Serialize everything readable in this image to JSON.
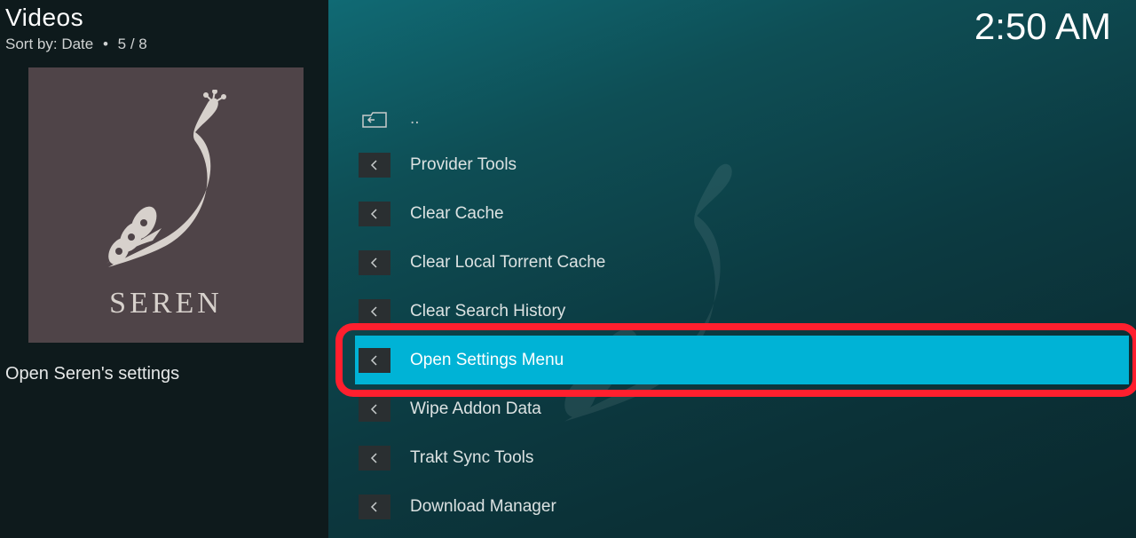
{
  "header": {
    "title": "Videos",
    "sort_prefix": "Sort by:",
    "sort_mode": "Date",
    "position": "5 / 8"
  },
  "clock": "2:50 AM",
  "thumbnail": {
    "caption": "SEREN"
  },
  "description": "Open Seren's settings",
  "menu": {
    "parent_label": "..",
    "items": [
      {
        "label": "Provider Tools"
      },
      {
        "label": "Clear Cache"
      },
      {
        "label": "Clear Local Torrent Cache"
      },
      {
        "label": "Clear Search History"
      },
      {
        "label": "Open Settings Menu",
        "selected": true,
        "highlighted": true
      },
      {
        "label": "Wipe Addon Data"
      },
      {
        "label": "Trakt Sync Tools"
      },
      {
        "label": "Download Manager"
      }
    ]
  }
}
